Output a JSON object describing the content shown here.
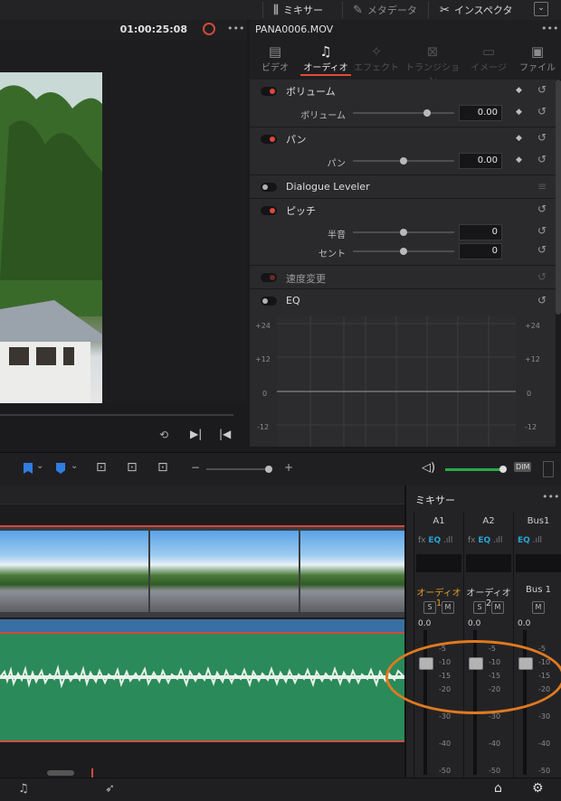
{
  "topbar": {
    "mixer_label": "ミキサー",
    "metadata_label": "メタデータ",
    "inspector_label": "インスペクタ"
  },
  "viewer": {
    "timecode": "01:00:25:08"
  },
  "inspector": {
    "clip_name": "PANA0006.MOV",
    "tabs": [
      {
        "label": "ビデオ",
        "icon": "video-icon"
      },
      {
        "label": "オーディオ",
        "icon": "music-note-icon"
      },
      {
        "label": "エフェクト",
        "icon": "magic-wand-icon"
      },
      {
        "label": "トランジション",
        "icon": "transition-icon"
      },
      {
        "label": "イメージ",
        "icon": "image-icon"
      },
      {
        "label": "ファイル",
        "icon": "file-icon"
      }
    ],
    "active_tab": "オーディオ",
    "volume": {
      "title": "ボリューム",
      "param_label": "ボリューム",
      "value": "0.00",
      "slider_fraction": 0.73
    },
    "pan": {
      "title": "パン",
      "param_label": "パン",
      "value": "0.00",
      "slider_fraction": 0.5
    },
    "dialogue_leveler": {
      "title": "Dialogue Leveler"
    },
    "pitch": {
      "title": "ピッチ",
      "semitone_label": "半音",
      "semitone_value": "0",
      "semitone_fraction": 0.5,
      "cents_label": "セント",
      "cents_value": "0",
      "cents_fraction": 0.5
    },
    "speed": {
      "title": "速度変更"
    },
    "eq": {
      "title": "EQ",
      "scale": [
        "+24",
        "+12",
        "0",
        "-12"
      ]
    }
  },
  "mixer": {
    "title": "ミキサー",
    "channels": [
      {
        "name": "A1",
        "track": "オーディオ 1",
        "buttons": [
          "S",
          "M"
        ],
        "db": "0.0",
        "fader_db": -10
      },
      {
        "name": "A2",
        "track": "オーディオ 2",
        "buttons": [
          "S",
          "M"
        ],
        "db": "0.0",
        "fader_db": -10
      },
      {
        "name": "Bus1",
        "track": "Bus 1",
        "buttons": [
          "M"
        ],
        "db": "0.0",
        "fader_db": -10
      }
    ],
    "fx_label": "fx",
    "eq_label": "EQ",
    "scale": [
      "-5",
      "-10",
      "-15",
      "-20",
      "-30",
      "-40",
      "-50"
    ]
  },
  "toolbar": {
    "dim_label": "DIM"
  },
  "colors": {
    "accent_red": "#e0473b",
    "orange_annotation": "#e07a20",
    "eq_blue": "#27a6d4",
    "audio_clip": "#2a8a5a",
    "video_clip_footer": "#3a6fa3"
  }
}
